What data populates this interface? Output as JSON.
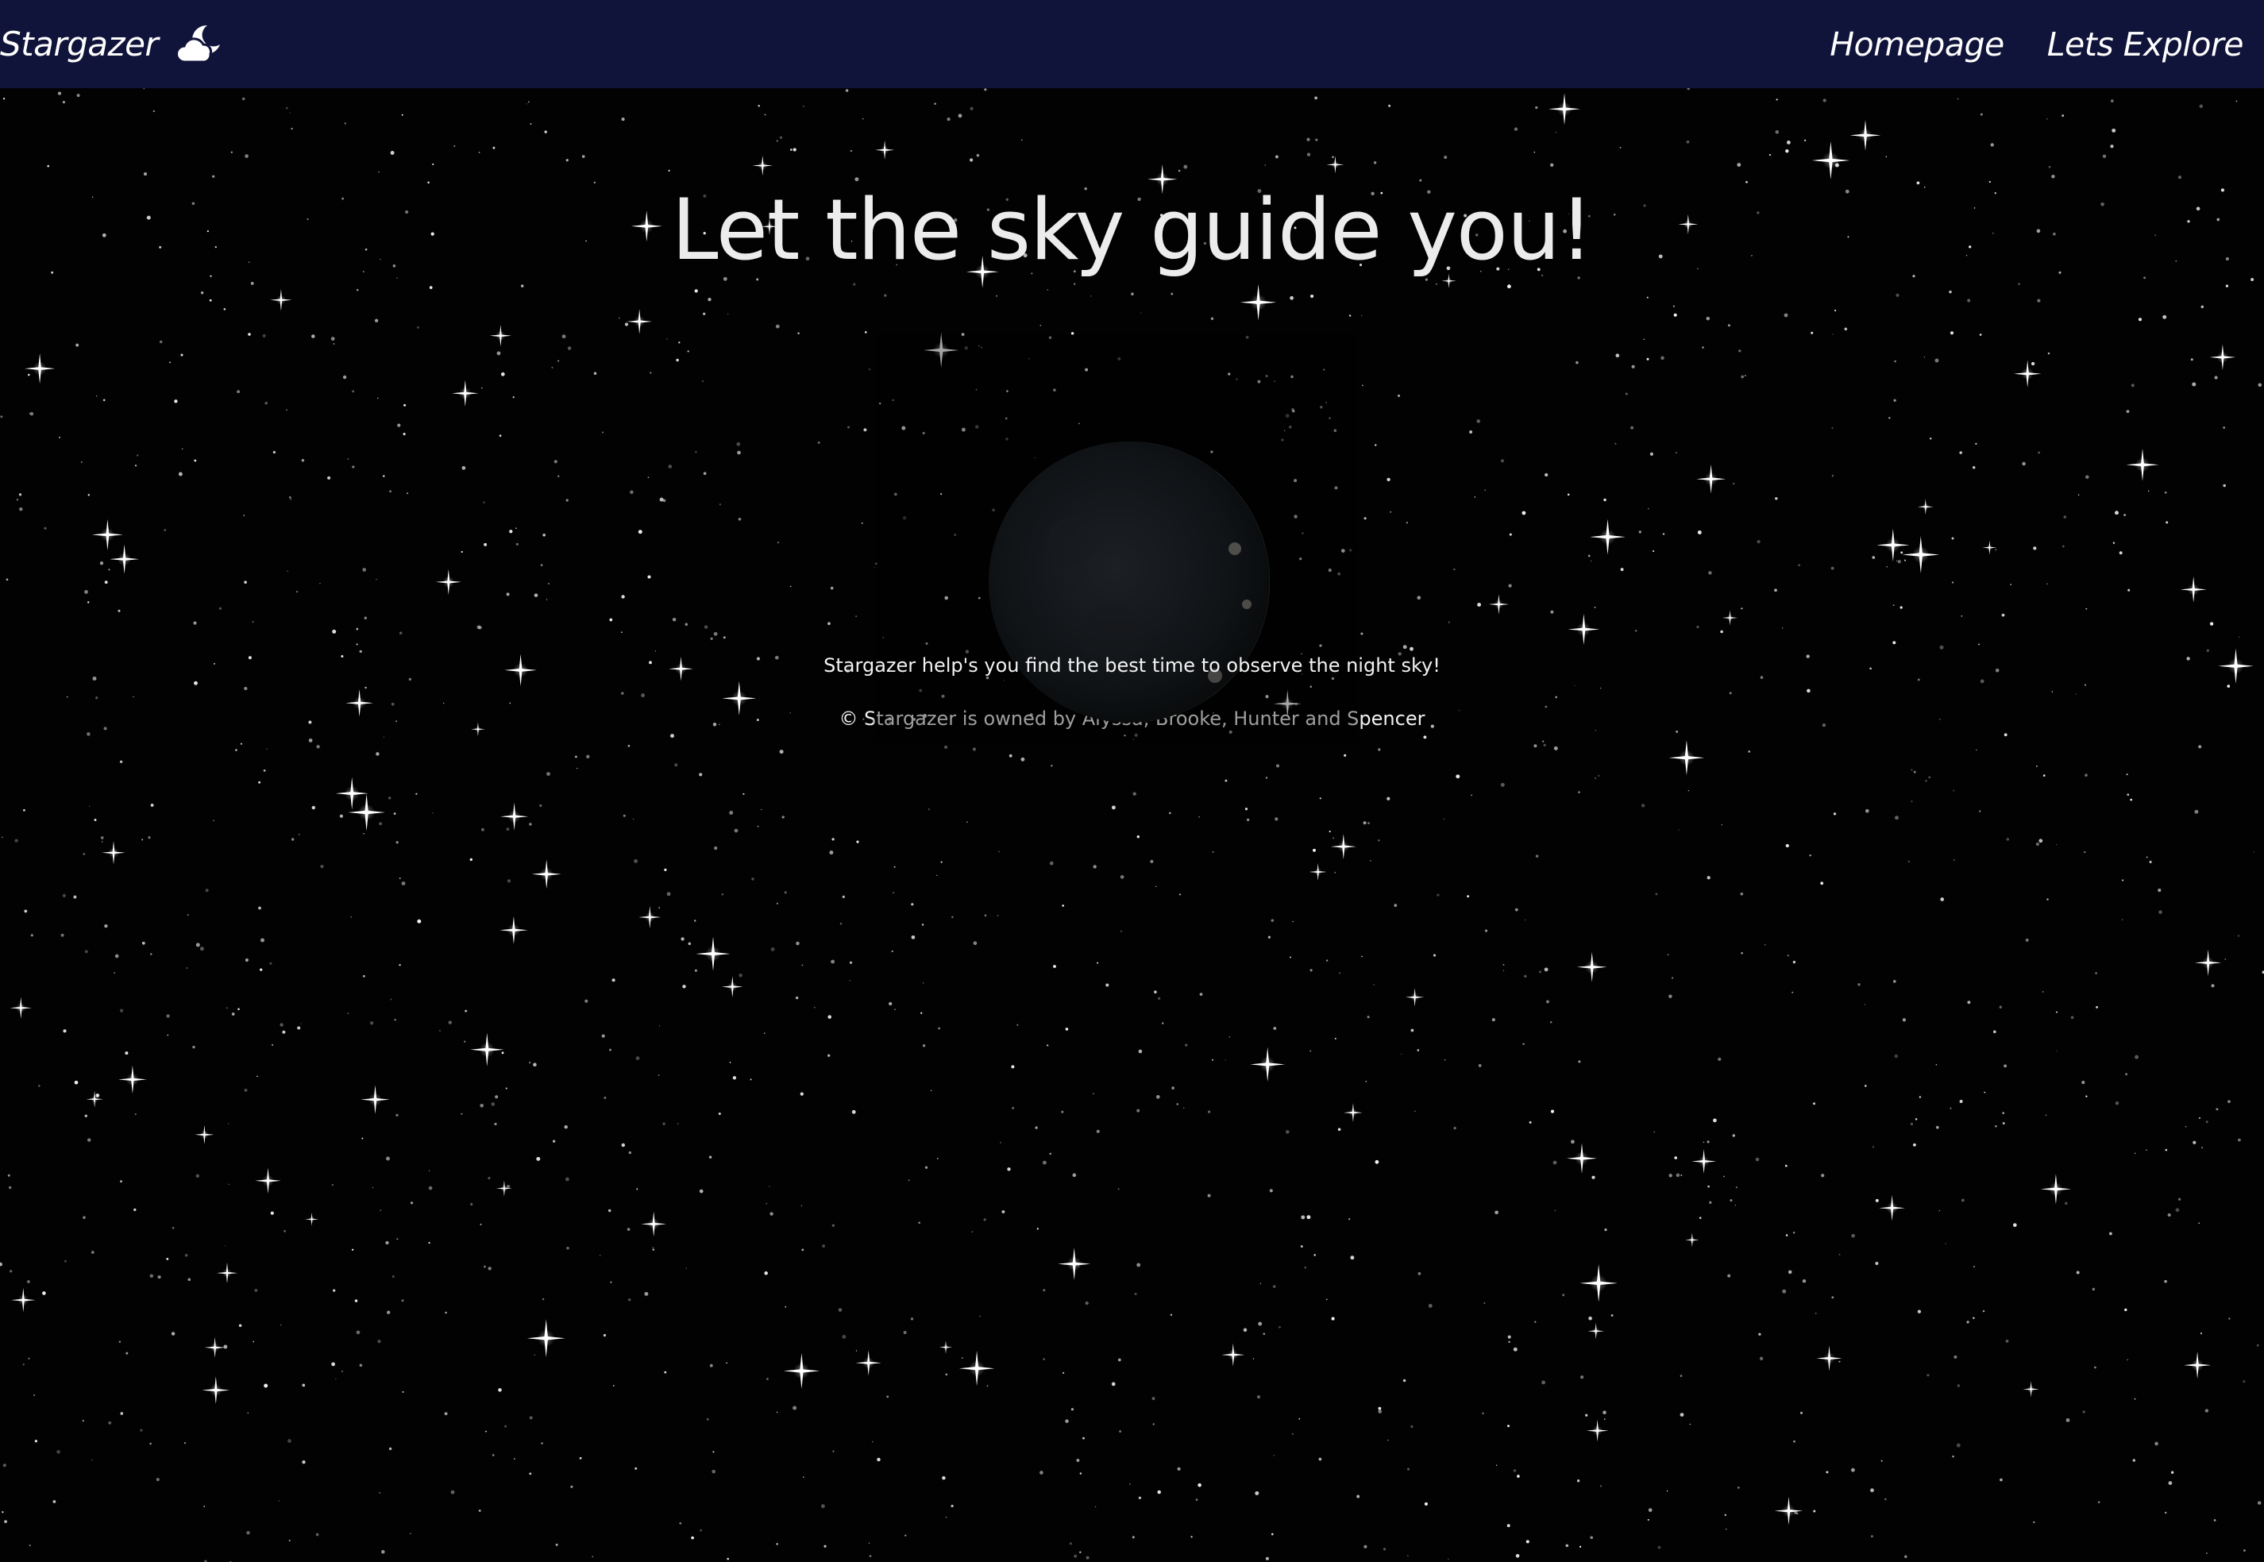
{
  "nav": {
    "brand": "Stargazer",
    "brand_icon": "cloud-moon-icon",
    "links": [
      {
        "label": "Homepage"
      },
      {
        "label": "Lets Explore"
      }
    ],
    "background": "#11143a"
  },
  "hero": {
    "title": "Let the sky guide you!",
    "image": "crescent-moon-image",
    "tagline": "Stargazer help's you find the best time to observe the night sky!"
  },
  "footer": {
    "text": "© Stargazer is owned by Alyssa, Brooke, Hunter and Spencer"
  },
  "colors": {
    "page_background": "#000000",
    "text": "#f2f2f2"
  }
}
